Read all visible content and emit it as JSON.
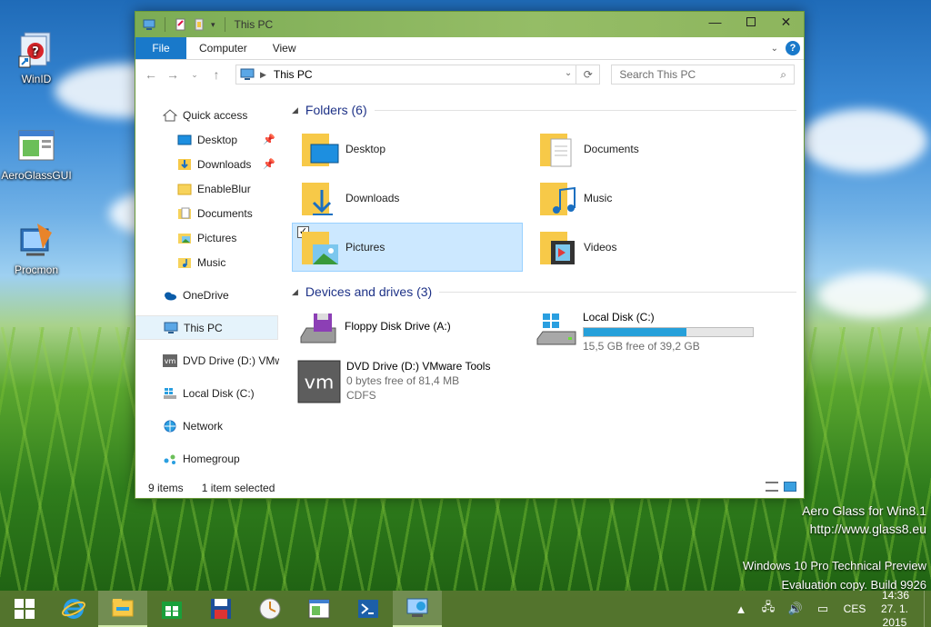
{
  "desktop": {
    "icons": [
      {
        "label": "WinID"
      },
      {
        "label": "AeroGlassGUI"
      },
      {
        "label": "Procmon"
      }
    ],
    "watermark": {
      "line1": "Aero Glass for Win8.1",
      "line2": "http://www.glass8.eu",
      "line3": "Windows 10 Pro Technical Preview",
      "line4": "Evaluation copy. Build 9926"
    }
  },
  "window": {
    "title": "This PC",
    "ribbon": {
      "file": "File",
      "computer": "Computer",
      "view": "View"
    },
    "address": {
      "crumb": "This PC"
    },
    "search": {
      "placeholder": "Search This PC"
    },
    "nav": {
      "quick_access": "Quick access",
      "items": [
        "Desktop",
        "Downloads",
        "EnableBlur",
        "Documents",
        "Pictures",
        "Music"
      ],
      "onedrive": "OneDrive",
      "this_pc": "This PC",
      "dvd": "DVD Drive (D:) VMware Tools",
      "local_disk": "Local Disk (C:)",
      "network": "Network",
      "homegroup": "Homegroup"
    },
    "folders": {
      "header": "Folders (6)",
      "items": [
        "Desktop",
        "Documents",
        "Downloads",
        "Music",
        "Pictures",
        "Videos"
      ]
    },
    "devices": {
      "header": "Devices and drives (3)",
      "floppy": {
        "name": "Floppy Disk Drive (A:)"
      },
      "local": {
        "name": "Local Disk (C:)",
        "free": "15,5 GB free of 39,2 GB",
        "used_fraction": 0.605
      },
      "dvd": {
        "name": "DVD Drive (D:) VMware Tools",
        "free": "0 bytes free of 81,4 MB",
        "fs": "CDFS"
      }
    },
    "status": {
      "items": "9 items",
      "selected": "1 item selected"
    }
  },
  "taskbar": {
    "language": "CES",
    "time": "14:36",
    "date": "27. 1. 2015"
  }
}
